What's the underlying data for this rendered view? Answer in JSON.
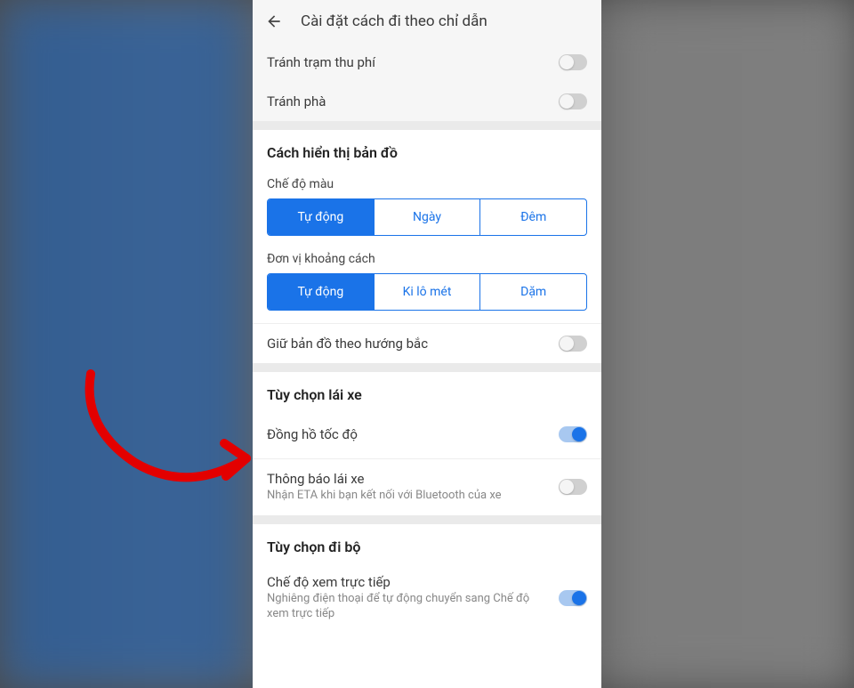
{
  "header": {
    "title": "Cài đặt cách đi theo chỉ dẫn"
  },
  "avoid": {
    "tolls": "Tránh trạm thu phí",
    "ferries": "Tránh phà"
  },
  "mapDisplay": {
    "title": "Cách hiển thị bản đồ",
    "colorMode": {
      "label": "Chế độ màu",
      "options": [
        "Tự động",
        "Ngày",
        "Đêm"
      ]
    },
    "distanceUnit": {
      "label": "Đơn vị khoảng cách",
      "options": [
        "Tự động",
        "Ki lô mét",
        "Dặm"
      ]
    },
    "northUp": "Giữ bản đồ theo hướng bắc"
  },
  "driving": {
    "title": "Tùy chọn lái xe",
    "speedometer": "Đồng hồ tốc độ",
    "notify": {
      "label": "Thông báo lái xe",
      "sub": "Nhận ETA khi bạn kết nối với Bluetooth của xe"
    }
  },
  "walking": {
    "title": "Tùy chọn đi bộ",
    "liveView": {
      "label": "Chế độ xem trực tiếp",
      "sub": "Nghiêng điện thoại để tự động chuyển sang Chế độ xem trực tiếp"
    }
  }
}
